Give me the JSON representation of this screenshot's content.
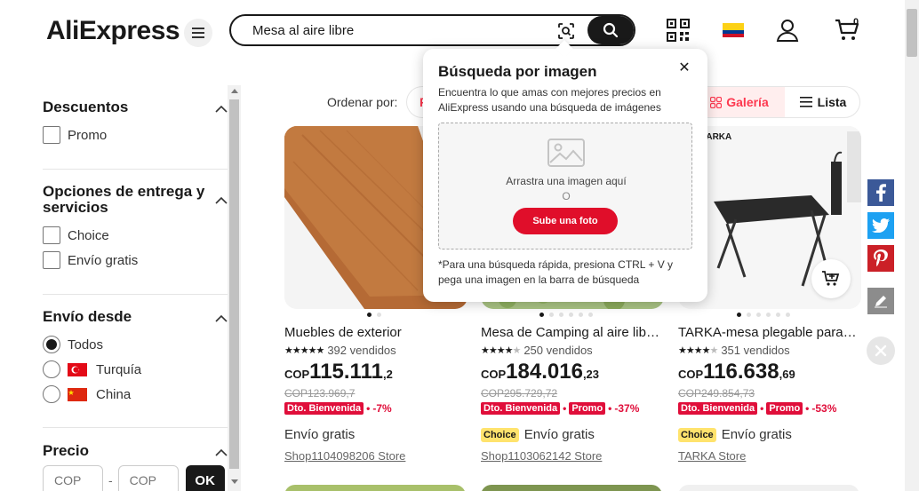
{
  "header": {
    "logo": "AliExpress",
    "search_value": "Mesa al aire libre",
    "cart_count": "0"
  },
  "sidebar": {
    "discounts": {
      "title": "Descuentos",
      "options": [
        "Promo"
      ]
    },
    "delivery": {
      "title": "Opciones de entrega y servicios",
      "options": [
        "Choice",
        "Envío gratis"
      ]
    },
    "ship_from": {
      "title": "Envío desde",
      "options": [
        "Todos",
        "Turquía",
        "China"
      ],
      "selected": "Todos"
    },
    "price": {
      "title": "Precio",
      "min_placeholder": "COP",
      "max_placeholder": "COP",
      "dash": "-",
      "ok": "OK"
    }
  },
  "sortbar": {
    "label": "Ordenar por:",
    "first_pill_initial": "F",
    "view_gallery": "Galería",
    "view_list": "Lista"
  },
  "products": [
    {
      "title": "Muebles de exterior",
      "sold": "392 vendidos",
      "rating": 5,
      "currency": "COP",
      "price_int": "115.111",
      "price_dec": ",2",
      "old_price": "COP123.969,7",
      "tags": [
        "Dto. Bienvenida"
      ],
      "discount": "-7%",
      "choice": false,
      "shipping": "Envío gratis",
      "store": "Shop1104098206 Store"
    },
    {
      "title": "Mesa de Camping al aire libre…",
      "sold": "250 vendidos",
      "rating": 4.5,
      "currency": "COP",
      "price_int": "184.016",
      "price_dec": ",23",
      "old_price": "COP295.729,72",
      "tags": [
        "Dto. Bienvenida",
        "Promo"
      ],
      "discount": "-37%",
      "choice": true,
      "shipping": "Envío gratis",
      "store": "Shop1103062142 Store"
    },
    {
      "title": "TARKA-mesa plegable para ac…",
      "sold": "351 vendidos",
      "rating": 4.5,
      "currency": "COP",
      "price_int": "116.638",
      "price_dec": ",69",
      "old_price": "COP249.854,73",
      "tags": [
        "Dto. Bienvenida",
        "Promo"
      ],
      "discount": "-53%",
      "choice": true,
      "shipping": "Envío gratis",
      "store": "TARKA Store",
      "brand_text": "TARKA"
    }
  ],
  "choice_label": "Choice",
  "popup": {
    "title": "Búsqueda por imagen",
    "description": "Encuentra lo que amas con mejores precios en AliExpress usando una búsqueda de imágenes",
    "drop_text": "Arrastra una imagen aquí",
    "or": "O",
    "upload_button": "Sube una foto",
    "footer": "*Para una búsqueda rápida, presiona CTRL + V y pega una imagen en la barra de búsqueda"
  },
  "colors": {
    "accent": "#fd384f",
    "promo_red": "#e00e3a",
    "choice_yellow": "#ffe36d",
    "facebook": "#3b5998",
    "twitter": "#1da1f2",
    "pinterest": "#cb2027"
  }
}
